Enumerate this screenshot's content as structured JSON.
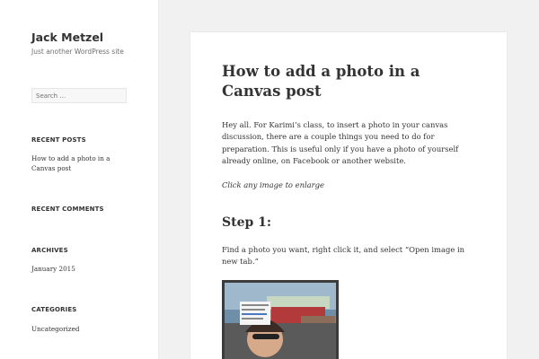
{
  "site": {
    "title": "Jack Metzel",
    "description": "Just another WordPress site"
  },
  "search": {
    "placeholder": "Search …"
  },
  "widgets": {
    "recent_posts": {
      "title": "RECENT POSTS",
      "items": [
        "How to add a photo in a Canvas post"
      ]
    },
    "recent_comments": {
      "title": "RECENT COMMENTS"
    },
    "archives": {
      "title": "ARCHIVES",
      "items": [
        "January 2015"
      ]
    },
    "categories": {
      "title": "CATEGORIES",
      "items": [
        "Uncategorized"
      ]
    }
  },
  "post": {
    "title": "How to add a photo in a Canvas post",
    "intro": "Hey all. For Karimi’s class, to insert a photo in your canvas discussion, there are a couple things you need to do for preparation. This is useful only if you have a photo of yourself already online, on Facebook or another website.",
    "note": "Click any image to enlarge",
    "step1_heading": "Step 1:",
    "step1_text": "Find a photo you want, right click it, and select “Open image in new tab.”"
  },
  "colors": {
    "background": "#f1f1f1",
    "panel": "#ffffff",
    "text": "#333333",
    "muted": "#707070"
  }
}
